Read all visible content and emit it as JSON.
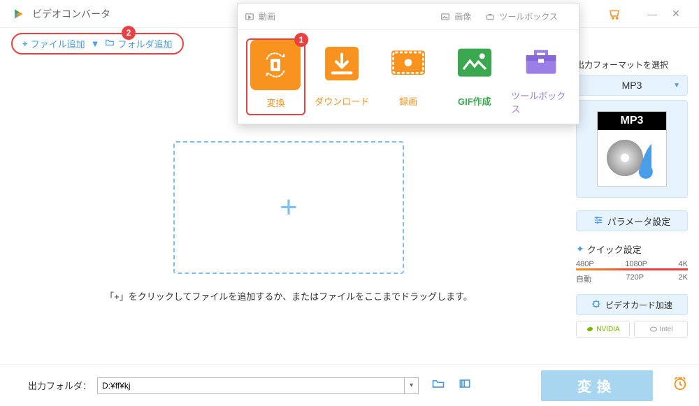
{
  "app": {
    "title": "ビデオコンバータ"
  },
  "toolbar": {
    "add_file": "ファイル追加",
    "add_folder": "フォルダ追加",
    "badge_step2": "2"
  },
  "popup": {
    "tabs": {
      "video": "動画",
      "image": "画像",
      "toolbox": "ツールボックス"
    },
    "tiles": {
      "convert": "変換",
      "download": "ダウンロード",
      "record": "録画",
      "gif": "GIF作成",
      "toolbox": "ツールボックス"
    },
    "badge_step1": "1"
  },
  "dropzone": {
    "hint": "「+」をクリックしてファイルを追加するか、またはファイルをここまでドラッグします。"
  },
  "side": {
    "title": "出力フォーマットを選択",
    "format": "MP3",
    "thumb_label": "MP3",
    "param_settings": "パラメータ設定",
    "quick_settings": "クイック設定",
    "presets_row1": {
      "a": "480P",
      "b": "1080P",
      "c": "4K"
    },
    "presets_row2": {
      "a": "自動",
      "b": "720P",
      "c": "2K"
    },
    "gpu_accel": "ビデオカード加速",
    "gpu_nvidia": "NVIDIA",
    "gpu_intel": "Intel"
  },
  "bottom": {
    "output_label": "出力フォルダ：",
    "output_path": "D:¥ff¥kj",
    "convert_btn": "変換"
  }
}
